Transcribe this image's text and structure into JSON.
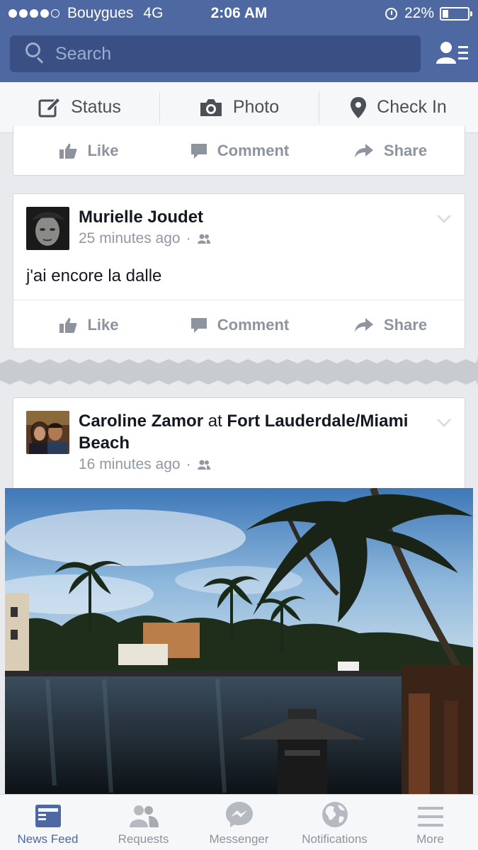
{
  "status_bar": {
    "carrier": "Bouygues",
    "network": "4G",
    "time": "2:06 AM",
    "battery": "22%"
  },
  "search": {
    "placeholder": "Search"
  },
  "composer": {
    "status_label": "Status",
    "photo_label": "Photo",
    "checkin_label": "Check In"
  },
  "actions": {
    "like": "Like",
    "comment": "Comment",
    "share": "Share"
  },
  "posts": [
    {
      "author": "Murielle Joudet",
      "time": "25 minutes ago",
      "text": "j'ai encore la dalle"
    },
    {
      "author": "Caroline Zamor",
      "at_word": "at",
      "place_line1": "Fort Lauderdale/Miami",
      "place_line2": "Beach",
      "time": "16 minutes ago"
    }
  ],
  "tabs": [
    {
      "label": "News Feed",
      "active": true
    },
    {
      "label": "Requests"
    },
    {
      "label": "Messenger"
    },
    {
      "label": "Notifications"
    },
    {
      "label": "More"
    }
  ],
  "colors": {
    "brand_blue": "#4e69a2",
    "search_bg": "#3a5085",
    "feed_bg": "#e9eaed",
    "muted_text": "#8d949e"
  }
}
